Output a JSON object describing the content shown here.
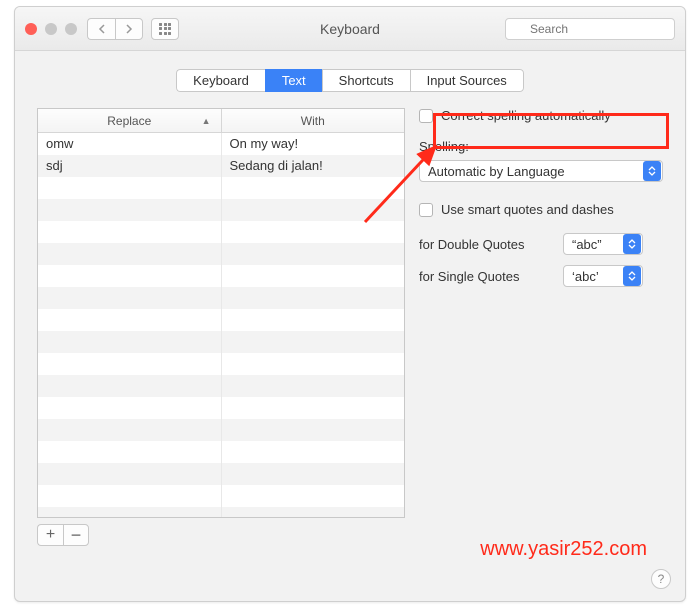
{
  "window": {
    "title": "Keyboard"
  },
  "search": {
    "placeholder": "Search"
  },
  "tabs": [
    {
      "label": "Keyboard",
      "active": false
    },
    {
      "label": "Text",
      "active": true
    },
    {
      "label": "Shortcuts",
      "active": false
    },
    {
      "label": "Input Sources",
      "active": false
    }
  ],
  "table": {
    "headers": {
      "replace": "Replace",
      "with": "With"
    },
    "rows": [
      {
        "replace": "omw",
        "with": "On my way!"
      },
      {
        "replace": "sdj",
        "with": "Sedang di jalan!"
      }
    ]
  },
  "options": {
    "correct_spelling": "Correct spelling automatically",
    "spelling_label": "Spelling:",
    "spelling_value": "Automatic by Language",
    "smart_quotes": "Use smart quotes and dashes",
    "double_quotes_label": "for Double Quotes",
    "double_quotes_value": "“abc”",
    "single_quotes_label": "for Single Quotes",
    "single_quotes_value": "‘abc’"
  },
  "watermark": "www.yasir252.com",
  "buttons": {
    "add": "+",
    "remove": "−",
    "help": "?"
  }
}
